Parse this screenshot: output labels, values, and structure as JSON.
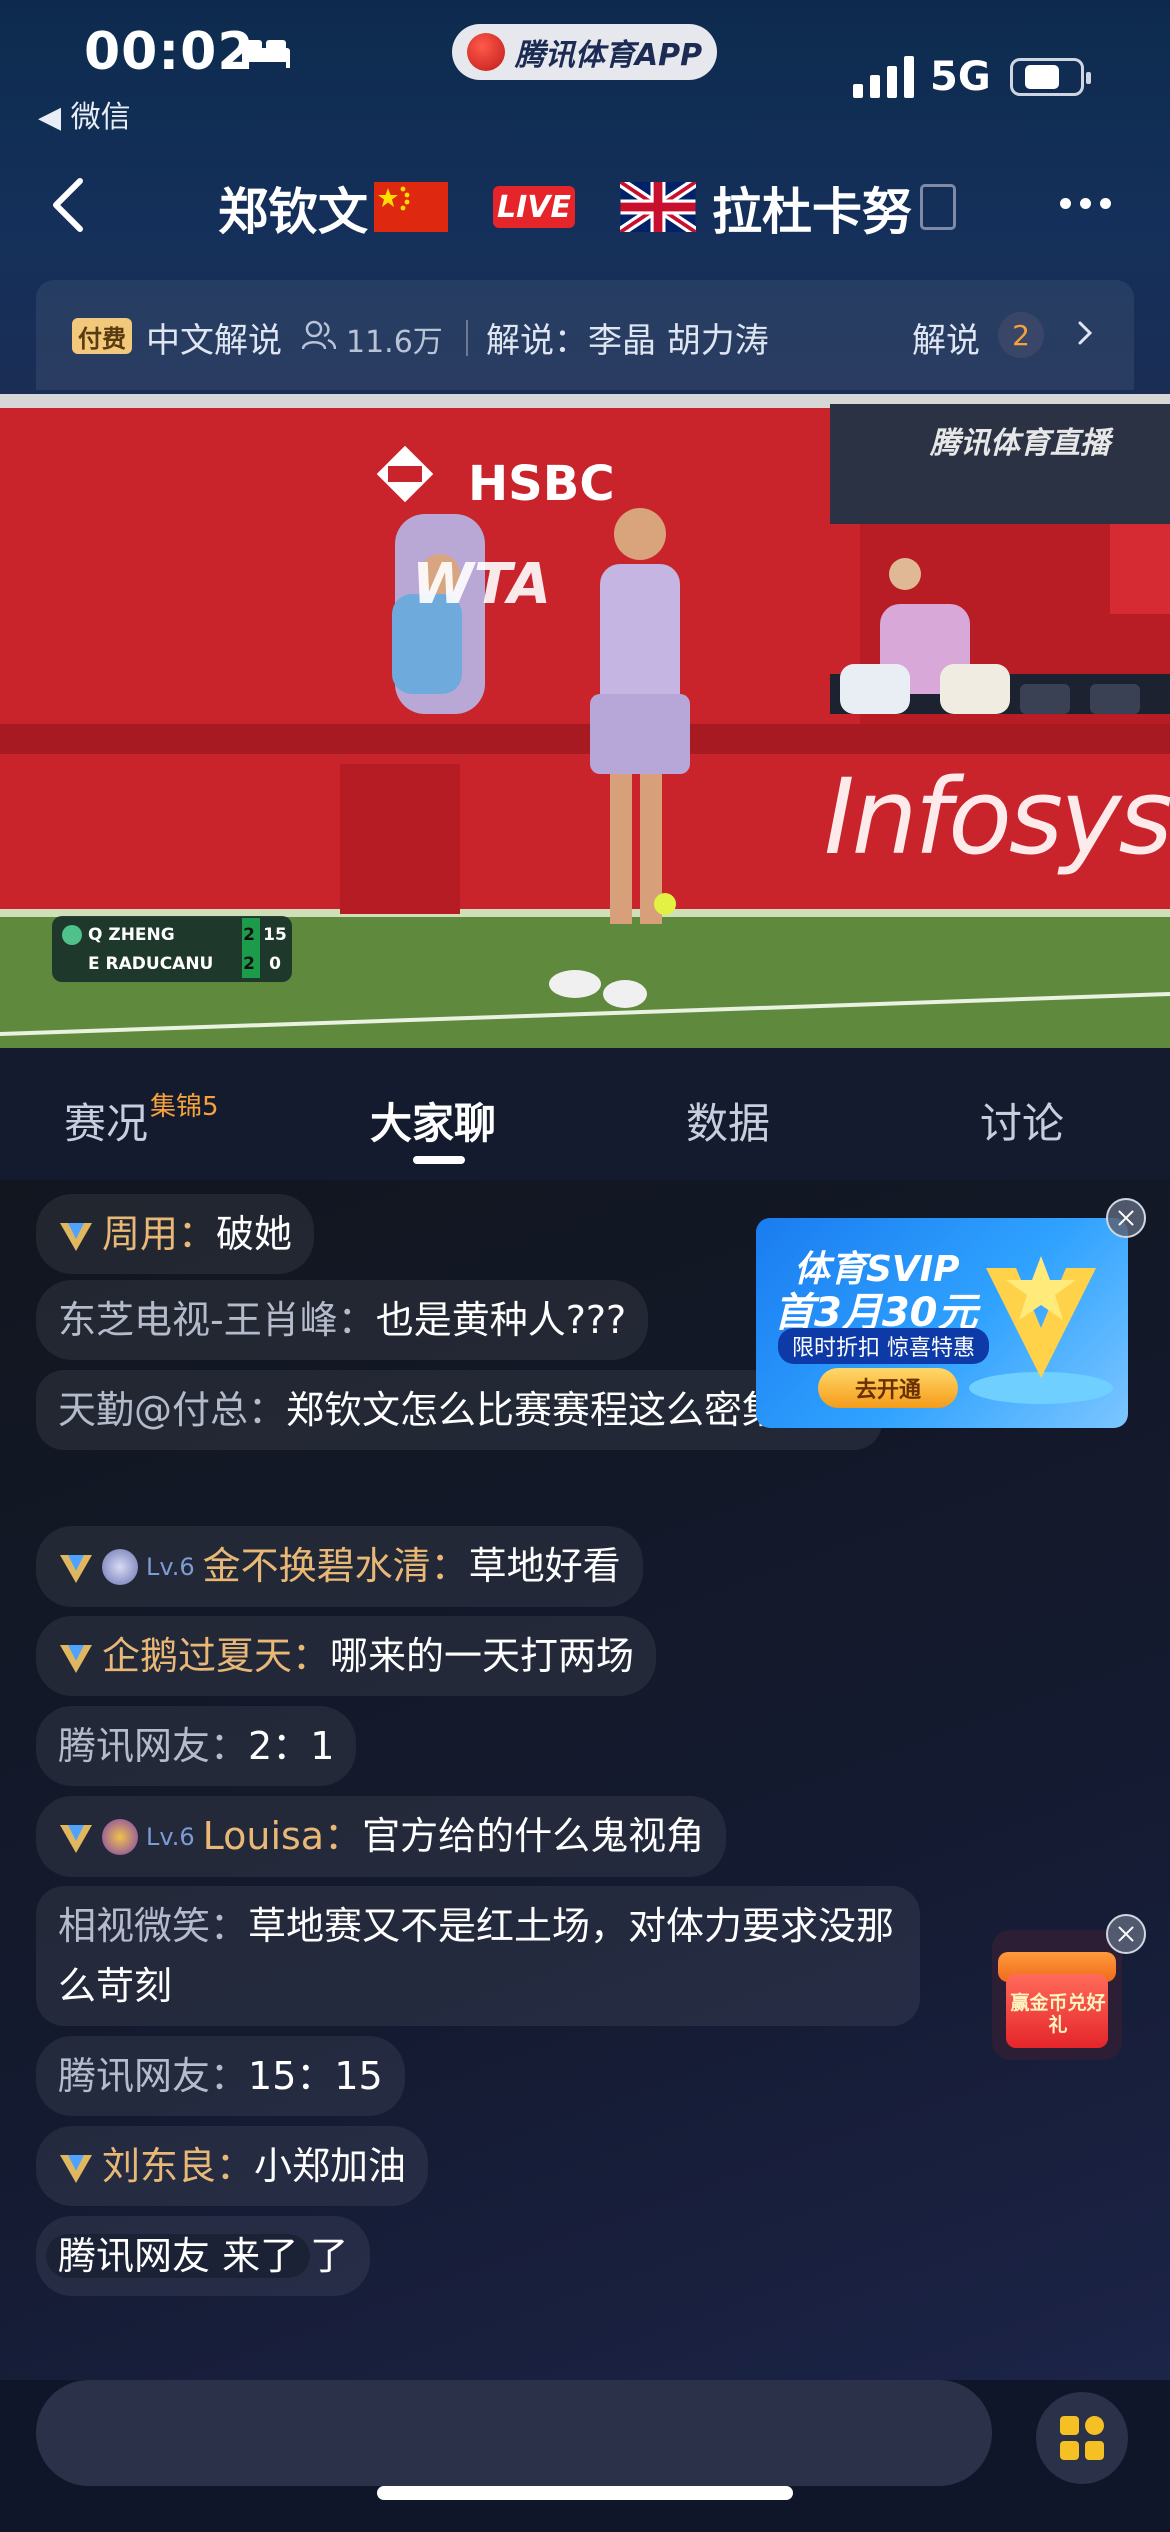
{
  "status_bar": {
    "time": "00:02",
    "back_app": "◀ 微信",
    "app_pill": "腾讯体育APP",
    "network": "5G"
  },
  "match": {
    "player_left": "郑钦文",
    "live_label": "LIVE",
    "player_right": "拉杜卡努"
  },
  "commentary": {
    "paid_badge": "付费",
    "channel": "中文解说",
    "viewers": "11.6万",
    "commentators": "解说：李晶 胡力涛",
    "switch_label": "解说",
    "switch_count": "2"
  },
  "video": {
    "watermark": "腾讯体育直播",
    "banner_brand": "HSBC",
    "board_text": "Infosys",
    "wta_text": "WTA",
    "score": {
      "rows": [
        {
          "player": "Q ZHENG",
          "sets": "2",
          "points": "15"
        },
        {
          "player": "E RADUCANU",
          "sets": "2",
          "points": "0"
        }
      ]
    }
  },
  "tabs": [
    {
      "label": "赛况",
      "badge": "集锦5"
    },
    {
      "label": "大家聊",
      "badge": ""
    },
    {
      "label": "数据",
      "badge": ""
    },
    {
      "label": "讨论",
      "badge": ""
    }
  ],
  "messages": [
    {
      "name": "周用：",
      "text": "破她",
      "vip": true
    },
    {
      "name": "东芝电视-王肖峰：",
      "text": "也是黄种人???",
      "vip": false
    },
    {
      "name": "天勤@付总：",
      "text": "郑钦文怎么比赛赛程这么密集啊",
      "vip": false
    },
    {
      "name": "金不换碧水清：",
      "text": "草地好看",
      "vip": true,
      "level": "Lv.6"
    },
    {
      "name": "企鹅过夏天：",
      "text": "哪来的一天打两场",
      "vip": true
    },
    {
      "name": "腾讯网友：",
      "text": "2：1",
      "vip": false
    },
    {
      "name": "Louisa：",
      "text": "官方给的什么鬼视角",
      "vip": true,
      "level": "Lv.6"
    },
    {
      "name": "相视微笑：",
      "text": "草地赛又不是红土场，对体力要求没那么苛刻",
      "vip": false
    },
    {
      "name": "腾讯网友：",
      "text": "15：15",
      "vip": false
    },
    {
      "name": "刘东良：",
      "text": "小郑加油",
      "vip": true
    },
    {
      "name": "腾讯网友 来了",
      "text": "了",
      "vip": false
    }
  ],
  "ad": {
    "line1": "体育SVIP",
    "line2": "首3月30元",
    "line3": "限时折扣 惊喜特惠",
    "button": "去开通"
  },
  "gift": {
    "text": "赢金币兑好礼"
  },
  "colors": {
    "accent": "#f5a23c",
    "live_red": "#e5252a",
    "vip_name": "#e9b877",
    "chat_bubble": "rgba(255,255,255,0.07)"
  }
}
